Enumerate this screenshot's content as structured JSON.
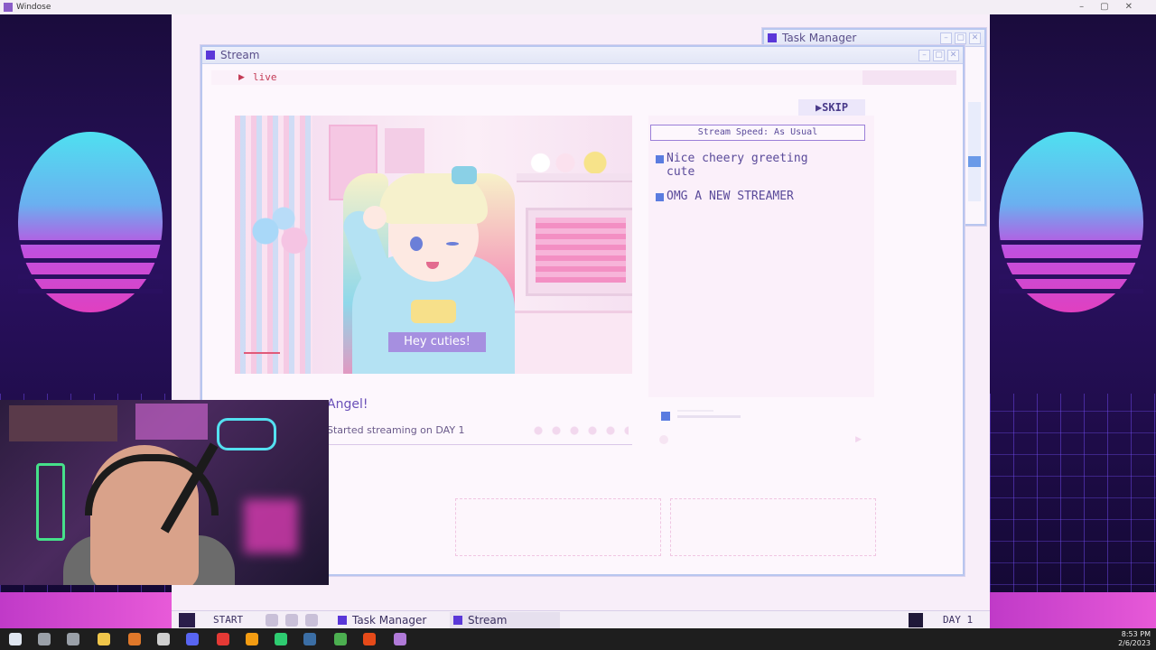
{
  "host_window": {
    "title": "Windose"
  },
  "task_manager_window": {
    "title": "Task Manager"
  },
  "stream_window": {
    "title": "Stream",
    "live_label": "live",
    "caption": "Hey cuties!",
    "stream_title": "Angel!",
    "started_text": "Started streaming on DAY 1",
    "skip_label": "▶SKIP",
    "speed_label": "Stream Speed: As Usual",
    "comments": [
      {
        "text": "Nice cheery greeting cute"
      },
      {
        "text": "OMG A NEW STREAMER"
      }
    ]
  },
  "taskbar": {
    "start_label": "START",
    "tasks": [
      {
        "label": "Task Manager"
      },
      {
        "label": "Stream"
      }
    ],
    "day_label": "DAY 1"
  },
  "clock": {
    "time": "8:53 PM",
    "date": "2/6/2023"
  },
  "colors": {
    "accent": "#5a37d8",
    "live": "#c33a55",
    "comment_marker": "#5a7ce0"
  }
}
